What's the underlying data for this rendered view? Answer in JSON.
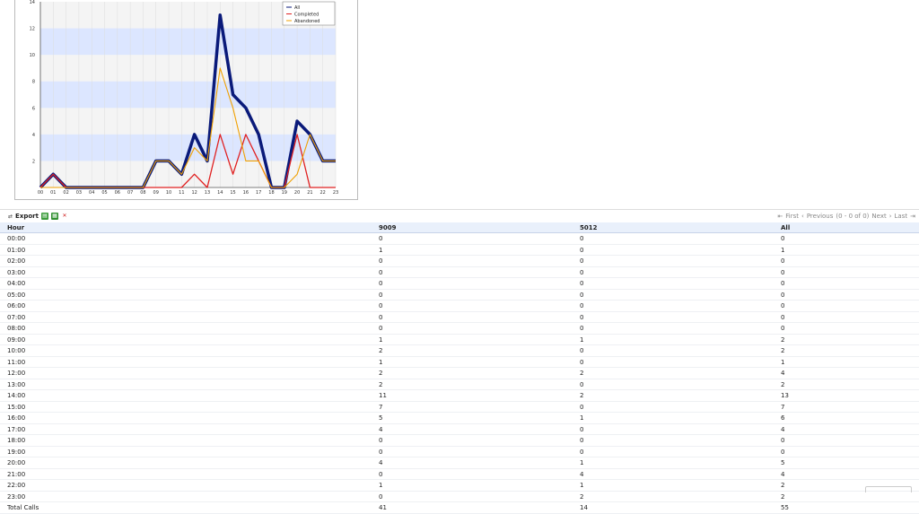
{
  "chart_data": {
    "type": "line",
    "x": [
      "00",
      "01",
      "02",
      "03",
      "04",
      "05",
      "06",
      "07",
      "08",
      "09",
      "10",
      "11",
      "12",
      "13",
      "14",
      "15",
      "16",
      "17",
      "18",
      "19",
      "20",
      "21",
      "22",
      "23"
    ],
    "ylim": [
      0,
      14
    ],
    "yticks": [
      "2",
      "4",
      "6",
      "8",
      "10",
      "12",
      "14"
    ],
    "series": [
      {
        "name": "All",
        "color": "#0a1a7a",
        "values": [
          0,
          1,
          0,
          0,
          0,
          0,
          0,
          0,
          0,
          2,
          2,
          1,
          4,
          2,
          13,
          7,
          6,
          4,
          0,
          0,
          5,
          4,
          2,
          2
        ]
      },
      {
        "name": "Completed",
        "color": "#e02020",
        "values": [
          0,
          1,
          0,
          0,
          0,
          0,
          0,
          0,
          0,
          0,
          0,
          0,
          1,
          0,
          4,
          1,
          4,
          2,
          0,
          0,
          4,
          0,
          0,
          0
        ]
      },
      {
        "name": "Abandoned",
        "color": "#f0a000",
        "values": [
          0,
          0,
          0,
          0,
          0,
          0,
          0,
          0,
          0,
          2,
          2,
          1,
          3,
          2,
          9,
          6,
          2,
          2,
          0,
          0,
          1,
          4,
          2,
          2
        ]
      }
    ],
    "legend": "top-right",
    "grid": true
  },
  "toolbar": {
    "export_label": "Export",
    "print_icon": "printer-icon",
    "excel_icon": "spreadsheet-icon",
    "pdf_icon": "pdf-icon",
    "first": "First",
    "previous": "Previous",
    "page_info": "(0 - 0 of 0)",
    "next": "Next",
    "last": "Last"
  },
  "table": {
    "headers": [
      "Hour",
      "9009",
      "5012",
      "All"
    ],
    "rows": [
      [
        "00:00",
        "0",
        "0",
        "0"
      ],
      [
        "01:00",
        "1",
        "0",
        "1"
      ],
      [
        "02:00",
        "0",
        "0",
        "0"
      ],
      [
        "03:00",
        "0",
        "0",
        "0"
      ],
      [
        "04:00",
        "0",
        "0",
        "0"
      ],
      [
        "05:00",
        "0",
        "0",
        "0"
      ],
      [
        "06:00",
        "0",
        "0",
        "0"
      ],
      [
        "07:00",
        "0",
        "0",
        "0"
      ],
      [
        "08:00",
        "0",
        "0",
        "0"
      ],
      [
        "09:00",
        "1",
        "1",
        "2"
      ],
      [
        "10:00",
        "2",
        "0",
        "2"
      ],
      [
        "11:00",
        "1",
        "0",
        "1"
      ],
      [
        "12:00",
        "2",
        "2",
        "4"
      ],
      [
        "13:00",
        "2",
        "0",
        "2"
      ],
      [
        "14:00",
        "11",
        "2",
        "13"
      ],
      [
        "15:00",
        "7",
        "0",
        "7"
      ],
      [
        "16:00",
        "5",
        "1",
        "6"
      ],
      [
        "17:00",
        "4",
        "0",
        "4"
      ],
      [
        "18:00",
        "0",
        "0",
        "0"
      ],
      [
        "19:00",
        "0",
        "0",
        "0"
      ],
      [
        "20:00",
        "4",
        "1",
        "5"
      ],
      [
        "21:00",
        "0",
        "4",
        "4"
      ],
      [
        "22:00",
        "1",
        "1",
        "2"
      ],
      [
        "23:00",
        "0",
        "2",
        "2"
      ]
    ],
    "total": [
      "Total Calls",
      "41",
      "14",
      "55"
    ]
  }
}
